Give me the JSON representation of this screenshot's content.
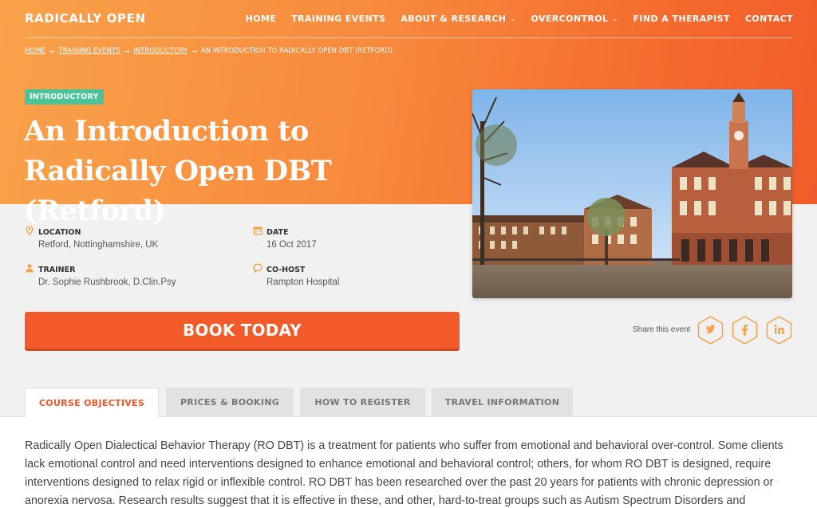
{
  "brand": "RADICALLY OPEN",
  "nav": [
    {
      "label": "HOME",
      "dropdown": false
    },
    {
      "label": "TRAINING EVENTS",
      "dropdown": false
    },
    {
      "label": "ABOUT & RESEARCH",
      "dropdown": true
    },
    {
      "label": "OVERCONTROL",
      "dropdown": true
    },
    {
      "label": "FIND A THERAPIST",
      "dropdown": false
    },
    {
      "label": "CONTACT",
      "dropdown": false
    }
  ],
  "breadcrumb": {
    "home": "HOME",
    "training": "TRAINING EVENTS",
    "introductory": "INTRODUCTORY",
    "current": "AN INTRODUCTION TO RADICALLY OPEN DBT (RETFORD)"
  },
  "badge": "INTRODUCTORY",
  "title": "An Introduction to Radically Open DBT (Retford)",
  "details": {
    "location": {
      "label": "LOCATION",
      "value": "Retford, Nottinghamshire, UK"
    },
    "date": {
      "label": "DATE",
      "value": "16 Oct 2017"
    },
    "trainer": {
      "label": "TRAINER",
      "value": "Dr. Sophie Rushbrook, D.Clin.Psy"
    },
    "cohost": {
      "label": "CO-HOST",
      "value": "Rampton Hospital"
    }
  },
  "book_label": "BOOK TODAY",
  "share": {
    "label": "Share this event",
    "networks": [
      "twitter-icon",
      "facebook-icon",
      "linkedin-icon"
    ]
  },
  "tabs": [
    "COURSE OBJECTIVES",
    "PRICES & BOOKING",
    "HOW TO REGISTER",
    "TRAVEL INFORMATION"
  ],
  "body_text": "Radically Open Dialectical Behavior Therapy (RO DBT) is a treatment for patients who suffer from emotional and behavioral over-control. Some clients lack emotional control and need interventions designed to enhance emotional and behavioral control; others, for whom RO DBT is designed, require interventions designed to relax rigid or inflexible control. RO DBT has been researched over the past 20 years for patients with chronic depression or anorexia nervosa. Research results suggest that it is effective in these, and other, hard-to-treat groups such as Autism Spectrum Disorders and",
  "colors": {
    "accent": "#f25a2a",
    "badge": "#4bc399",
    "icon": "#f5a14a",
    "tab_active": "#f0562a"
  }
}
